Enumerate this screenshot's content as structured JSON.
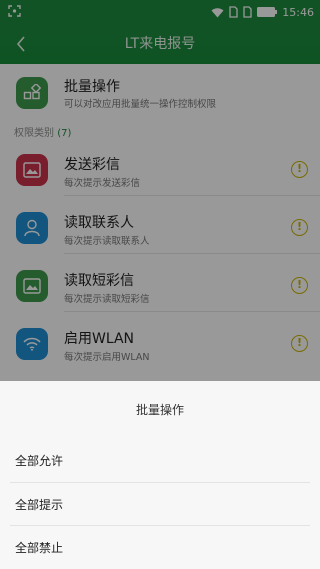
{
  "status_bar": {
    "time": "15:46"
  },
  "app_bar": {
    "title": "LT来电报号"
  },
  "batch": {
    "title": "批量操作",
    "subtitle": "可以对改应用批量统一操作控制权限"
  },
  "section": {
    "label": "权限类别",
    "count": "(7)"
  },
  "permissions": [
    {
      "title": "发送彩信",
      "subtitle": "每次提示发送彩信",
      "icon": "image-icon",
      "color": "#c8324a"
    },
    {
      "title": "读取联系人",
      "subtitle": "每次提示读取联系人",
      "icon": "person-icon",
      "color": "#1e8fd6"
    },
    {
      "title": "读取短彩信",
      "subtitle": "每次提示读取短彩信",
      "icon": "message-image-icon",
      "color": "#3d9a4c"
    },
    {
      "title": "启用WLAN",
      "subtitle": "每次提示启用WLAN",
      "icon": "wifi-icon",
      "color": "#1e8fd6"
    }
  ],
  "sheet": {
    "title": "批量操作",
    "options": [
      "全部允许",
      "全部提示",
      "全部禁止"
    ]
  },
  "colors": {
    "accent": "#1f8a3f",
    "warning": "#c9b400"
  }
}
